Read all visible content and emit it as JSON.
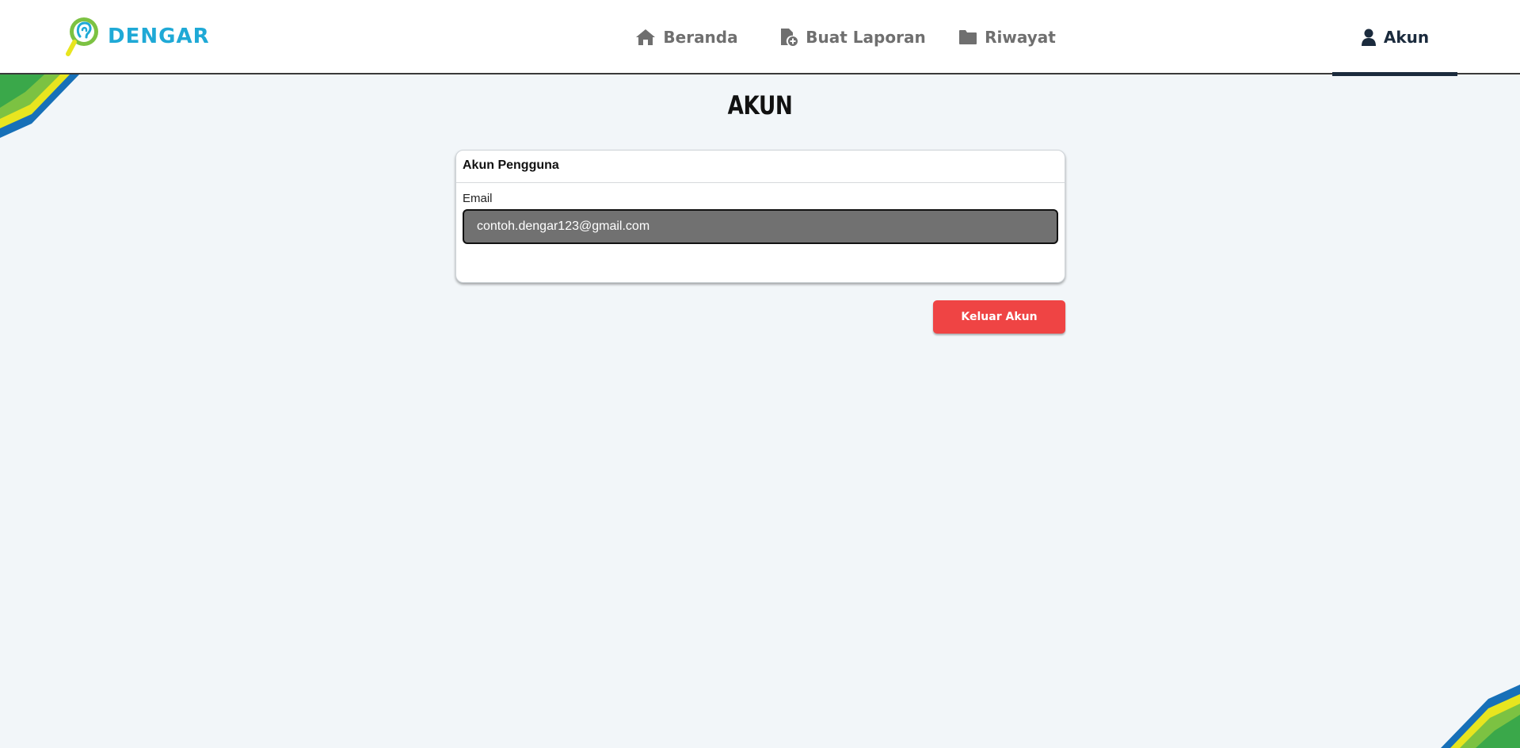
{
  "app": {
    "name": "DENGAR"
  },
  "nav": {
    "items": [
      {
        "label": "Beranda",
        "icon": "home-icon"
      },
      {
        "label": "Buat Laporan",
        "icon": "file-plus-icon"
      },
      {
        "label": "Riwayat",
        "icon": "folder-icon"
      },
      {
        "label": "Akun",
        "icon": "user-icon",
        "active": true
      }
    ]
  },
  "page": {
    "title": "AKUN"
  },
  "account_card": {
    "header": "Akun Pengguna",
    "email_label": "Email",
    "email_value": "contoh.dengar123@gmail.com"
  },
  "actions": {
    "logout_label": "Keluar Akun"
  },
  "colors": {
    "accent": "#1fa9d6",
    "nav_active": "#1b2b3d",
    "danger": "#ef4444",
    "background": "#f2f6f9"
  }
}
